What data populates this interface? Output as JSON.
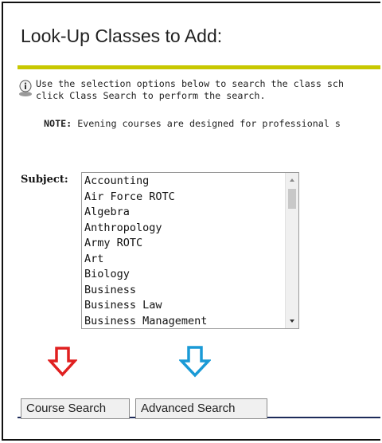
{
  "page": {
    "title": "Look-Up Classes to Add:"
  },
  "info": {
    "icon": "info-icon",
    "line1": "Use the selection options below to search the class sch",
    "line2": "click Class Search to perform the search."
  },
  "note": {
    "label": "NOTE:",
    "text": " Evening courses are designed for professional s"
  },
  "subject": {
    "label": "Subject:",
    "options": [
      "Accounting",
      "Air Force ROTC",
      "Algebra",
      "Anthropology",
      "Army ROTC",
      "Art",
      "Biology",
      "Business",
      "Business Law",
      "Business Management"
    ]
  },
  "arrows": [
    {
      "icon": "down-arrow-icon",
      "color": "#e02020"
    },
    {
      "icon": "down-arrow-icon",
      "color": "#1a9ad6"
    }
  ],
  "buttons": {
    "course_search": "Course Search",
    "advanced_search": "Advanced Search"
  },
  "colors": {
    "accent_bar": "#c8c800",
    "bottom_line": "#1d2b5a"
  }
}
